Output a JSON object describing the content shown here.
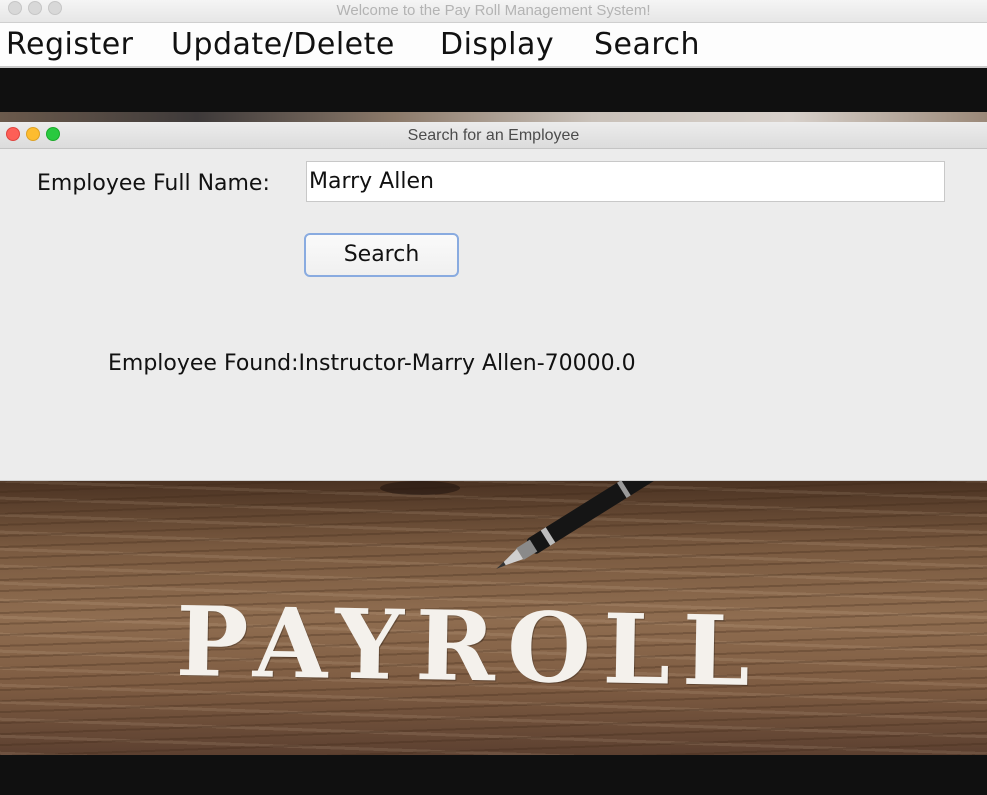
{
  "main_window": {
    "title": "Welcome to the Pay Roll Management System!",
    "menu": [
      {
        "label": "Register"
      },
      {
        "label": "Update/Delete"
      },
      {
        "label": "Display"
      },
      {
        "label": "Search"
      }
    ]
  },
  "dialog": {
    "title": "Search for an Employee",
    "name_label": "Employee Full Name:",
    "name_value": "Marry Allen",
    "search_button": "Search",
    "result": "Employee Found:Instructor-Marry Allen-70000.0"
  },
  "background": {
    "image_text": "PAYROLL"
  },
  "colors": {
    "close": "#fd5f57",
    "minimize": "#fdbc2f",
    "maximize": "#29c940",
    "button_focus": "#89abe0",
    "dialog_bg": "#ececec"
  }
}
